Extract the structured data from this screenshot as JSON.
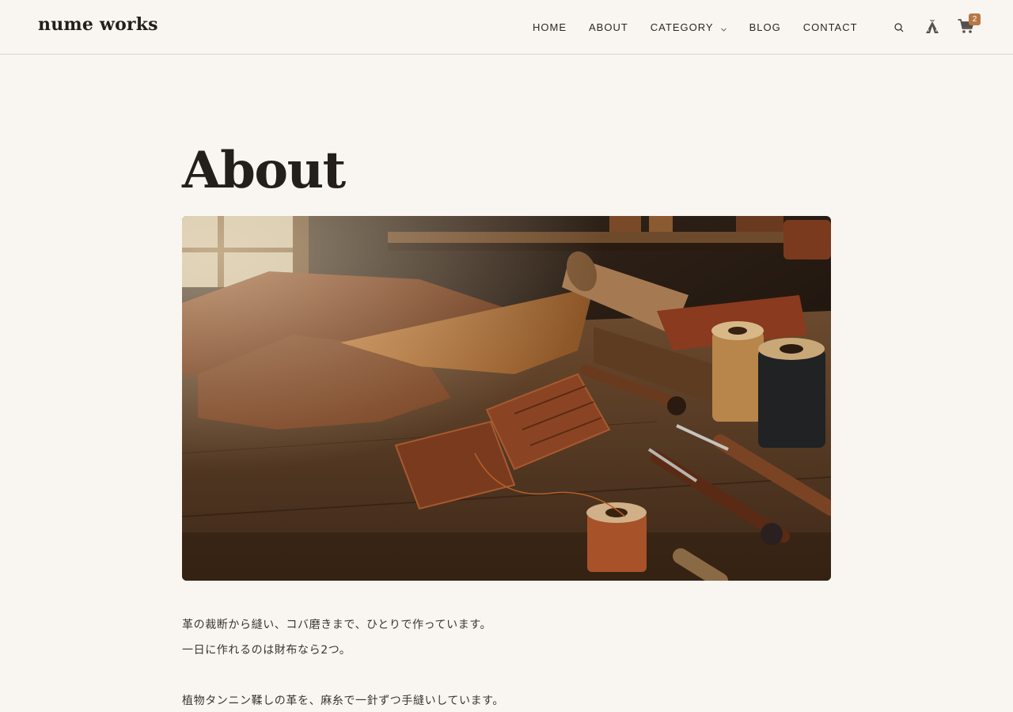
{
  "header": {
    "logo": "nume works",
    "nav": [
      {
        "label": "HOME"
      },
      {
        "label": "ABOUT"
      },
      {
        "label": "CATEGORY",
        "has_dropdown": true
      },
      {
        "label": "BLOG"
      },
      {
        "label": "CONTACT"
      }
    ],
    "icons": [
      "search-icon",
      "tent-icon",
      "cart-icon"
    ],
    "cart_count": "2"
  },
  "main": {
    "title": "About",
    "hero_image": "leather-workshop-photo",
    "paragraphs": [
      "革の裁断から縫い、コバ磨きまで、ひとりで作っています。",
      "一日に作れるのは財布なら2つ。",
      "植物タンニン鞣しの革を、麻糸で一針ずつ手縫いしています。"
    ]
  },
  "colors": {
    "background": "#f9f6f1",
    "text": "#2b2622",
    "accent": "#b77845",
    "divider": "#d9d4cd"
  }
}
